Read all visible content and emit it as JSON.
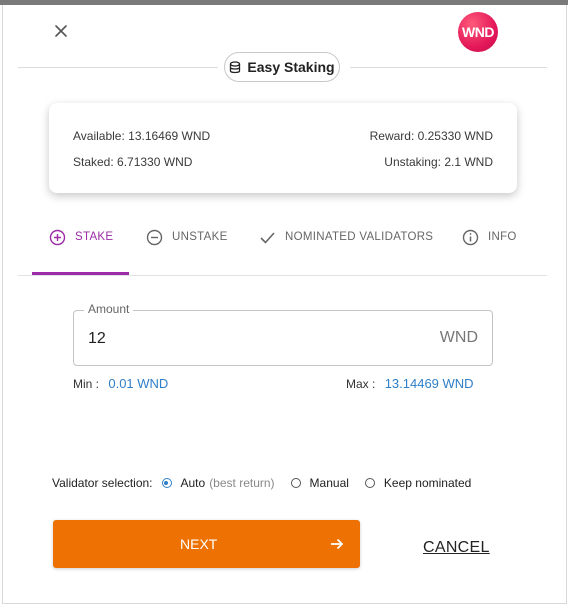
{
  "header": {
    "logo_text": "WND",
    "pill_label": "Easy Staking"
  },
  "stats": {
    "available": "Available: 13.16469 WND",
    "staked": "Staked: 6.71330 WND",
    "reward": "Reward: 0.25330 WND",
    "unstaking": "Unstaking: 2.1 WND"
  },
  "tabs": [
    {
      "label": "STAKE",
      "icon": "plus-circle-icon",
      "active": true
    },
    {
      "label": "UNSTAKE",
      "icon": "minus-circle-icon",
      "active": false
    },
    {
      "label": "NOMINATED VALIDATORS",
      "icon": "check-icon",
      "active": false
    },
    {
      "label": "INFO",
      "icon": "info-circle-icon",
      "active": false
    }
  ],
  "amount": {
    "label": "Amount",
    "value": "12",
    "unit": "WND"
  },
  "limits": {
    "min_label": "Min :",
    "min_value": "0.01 WND",
    "max_label": "Max :",
    "max_value": "13.14469 WND"
  },
  "validator_selection": {
    "label": "Validator selection:",
    "options": [
      {
        "label": "Auto",
        "hint": "(best return)",
        "selected": true
      },
      {
        "label": "Manual",
        "selected": false
      },
      {
        "label": "Keep nominated",
        "selected": false
      }
    ]
  },
  "actions": {
    "next_label": "NEXT",
    "cancel_label": "CANCEL"
  },
  "colors": {
    "accent": "#9b2ba6",
    "primary_button": "#ee7203",
    "link": "#2f7fc8",
    "logo": "#e4185a"
  }
}
